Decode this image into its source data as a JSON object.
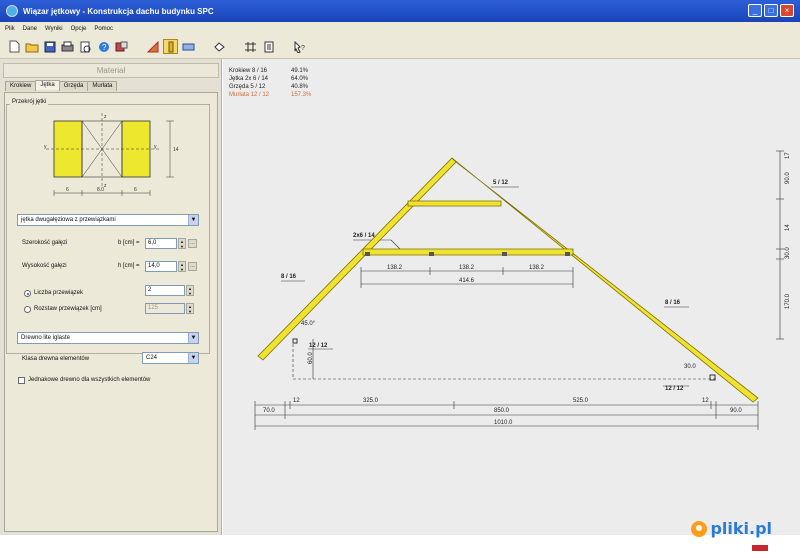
{
  "window": {
    "title": "Wiązar jętkowy - Konstrukcja dachu budynku SPC",
    "btn_min": "_",
    "btn_max": "□",
    "btn_close": "×"
  },
  "menu": [
    "Plik",
    "Dane",
    "Wyniki",
    "Opcje",
    "Pomoc"
  ],
  "toolbar_icons": [
    "new-file-icon",
    "open-folder-icon",
    "save-icon",
    "print-icon",
    "print-preview-icon",
    "help-icon",
    "settings-icon",
    "warning-triangle-icon",
    "ruler-icon",
    "view-icon",
    "rotate-icon",
    "dimension-icon",
    "report-icon",
    "context-help-icon"
  ],
  "panel": {
    "header": "Materiał",
    "tabs": [
      "Krokiew",
      "Jętka",
      "Grzęda",
      "Murłata"
    ],
    "active_tab": 1,
    "group_title": "Przekrój jętki",
    "section_labels": {
      "left_dim": "6",
      "mid_dim": "8.0",
      "right_dim": "6",
      "height": "14",
      "axis_top": "z",
      "axis_bottom": "z",
      "axis_left": "y",
      "axis_right": "y"
    },
    "section_type": "jętka dwugałęziowa z przewiązkami",
    "width_label": "Szerokość gałęzi",
    "width_sym": "b [cm] =",
    "width_value": "6,0",
    "height_label": "Wysokość gałęzi",
    "height_sym": "h [cm] =",
    "height_value": "14,0",
    "radio_count_label": "Liczba przewiązek",
    "radio_count_value": "2",
    "radio_spacing_label": "Rozstaw przewiązek [cm]",
    "radio_spacing_value": "125",
    "wood_type": "Drewno lite iglaste",
    "wood_class_label": "Klasa drewna elementów",
    "wood_class": "C24",
    "checkbox_label": "Jednakowe drewno dla wszystkich elementów"
  },
  "results": [
    {
      "name": "Krokiew 8 / 16",
      "value": "49.1%",
      "color": "#222222"
    },
    {
      "name": "Jętka    2x 6 / 14",
      "value": "64.0%",
      "color": "#222222"
    },
    {
      "name": "Grzęda  5 / 12",
      "value": "40.8%",
      "color": "#222222"
    },
    {
      "name": "Murłata 12 / 12",
      "value": "157.3%",
      "color": "#d06a3a"
    }
  ],
  "drawing": {
    "label_rafter_left": "8 / 16",
    "label_rafter_right": "8 / 16",
    "label_collar": "2x6 / 14",
    "label_ridge": "5 / 12",
    "label_plate_left": "12 / 12",
    "label_plate_right": "12 / 12",
    "angle": "45.0°",
    "collar_dims": [
      "138.2",
      "138.2",
      "138.2"
    ],
    "collar_total": "414.6",
    "plate_height": "60.0",
    "plate_offset": "30.0",
    "bottom_dims_row1": [
      "70.0",
      "12",
      "325.0",
      "525.0",
      "12",
      "90.0"
    ],
    "span": "850.0",
    "total": "1010.0",
    "right_dims": [
      "17",
      "90.0",
      "14",
      "30.0",
      "170.0"
    ]
  },
  "watermark": "pliki.pl"
}
